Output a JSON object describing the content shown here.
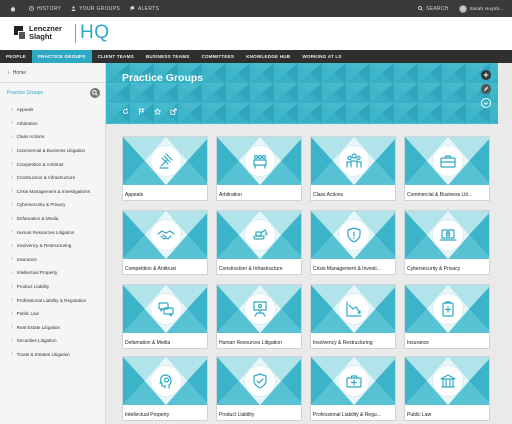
{
  "topbar": {
    "home_icon": "home-icon",
    "history": "HISTORY",
    "your_groups": "YOUR GROUPS",
    "alerts": "ALERTS",
    "search": "SEARCH",
    "user": "Sarah Huynh..."
  },
  "brand": {
    "line1": "Lenczner",
    "line2": "Slaght",
    "hq": "HQ"
  },
  "nav": [
    {
      "label": "PEOPLE",
      "active": false
    },
    {
      "label": "PRACTICE GROUPS",
      "active": true
    },
    {
      "label": "CLIENT TEAMS",
      "active": false
    },
    {
      "label": "BUSINESS TEAMS",
      "active": false
    },
    {
      "label": "COMMITTEES",
      "active": false
    },
    {
      "label": "KNOWLEDGE HUB",
      "active": false
    },
    {
      "label": "WORKING AT LS",
      "active": false
    }
  ],
  "sidebar": {
    "home": "Home",
    "title": "Practice Groups",
    "items": [
      "Appeals",
      "Arbitration",
      "Class Actions",
      "Commercial & Business Litigation",
      "Competition & Antitrust",
      "Construction & Infrastructure",
      "Crisis Management & Investigations",
      "Cybersecurity & Privacy",
      "Defamation & Media",
      "Human Resources Litigation",
      "Insolvency & Restructuring",
      "Insurance",
      "Intellectual Property",
      "Product Liability",
      "Professional Liability & Regulation",
      "Public Law",
      "Real Estate Litigation",
      "Securities Litigation",
      "Trusts & Estates Litigation"
    ]
  },
  "banner": {
    "title": "Practice Groups"
  },
  "colors": {
    "accent": "#2ea9c4",
    "dark": "#2f2f2f"
  },
  "tiles": [
    {
      "label": "Appeals",
      "icon": "gavel-icon"
    },
    {
      "label": "Arbitration",
      "icon": "meeting-table-icon"
    },
    {
      "label": "Class Actions",
      "icon": "group-people-icon"
    },
    {
      "label": "Commercial & Business Liti...",
      "icon": "briefcase-icon"
    },
    {
      "label": "Competition & Antitrust",
      "icon": "handshake-icon"
    },
    {
      "label": "Construction & Infrastructure",
      "icon": "excavator-icon"
    },
    {
      "label": "Crisis Management & Investi...",
      "icon": "warning-shield-icon"
    },
    {
      "label": "Cybersecurity & Privacy",
      "icon": "laptop-lock-icon"
    },
    {
      "label": "Defamation & Media",
      "icon": "speech-bubbles-icon"
    },
    {
      "label": "Human Resources Litigation",
      "icon": "presentation-icon"
    },
    {
      "label": "Insolvency & Restructuring",
      "icon": "declining-chart-icon"
    },
    {
      "label": "Insurance",
      "icon": "medical-clipboard-icon"
    },
    {
      "label": "Intellectual Property",
      "icon": "head-lightbulb-icon"
    },
    {
      "label": "Product Liability",
      "icon": "shield-check-icon"
    },
    {
      "label": "Professional Liability & Regu...",
      "icon": "medical-bag-icon"
    },
    {
      "label": "Public Law",
      "icon": "government-building-icon"
    }
  ]
}
